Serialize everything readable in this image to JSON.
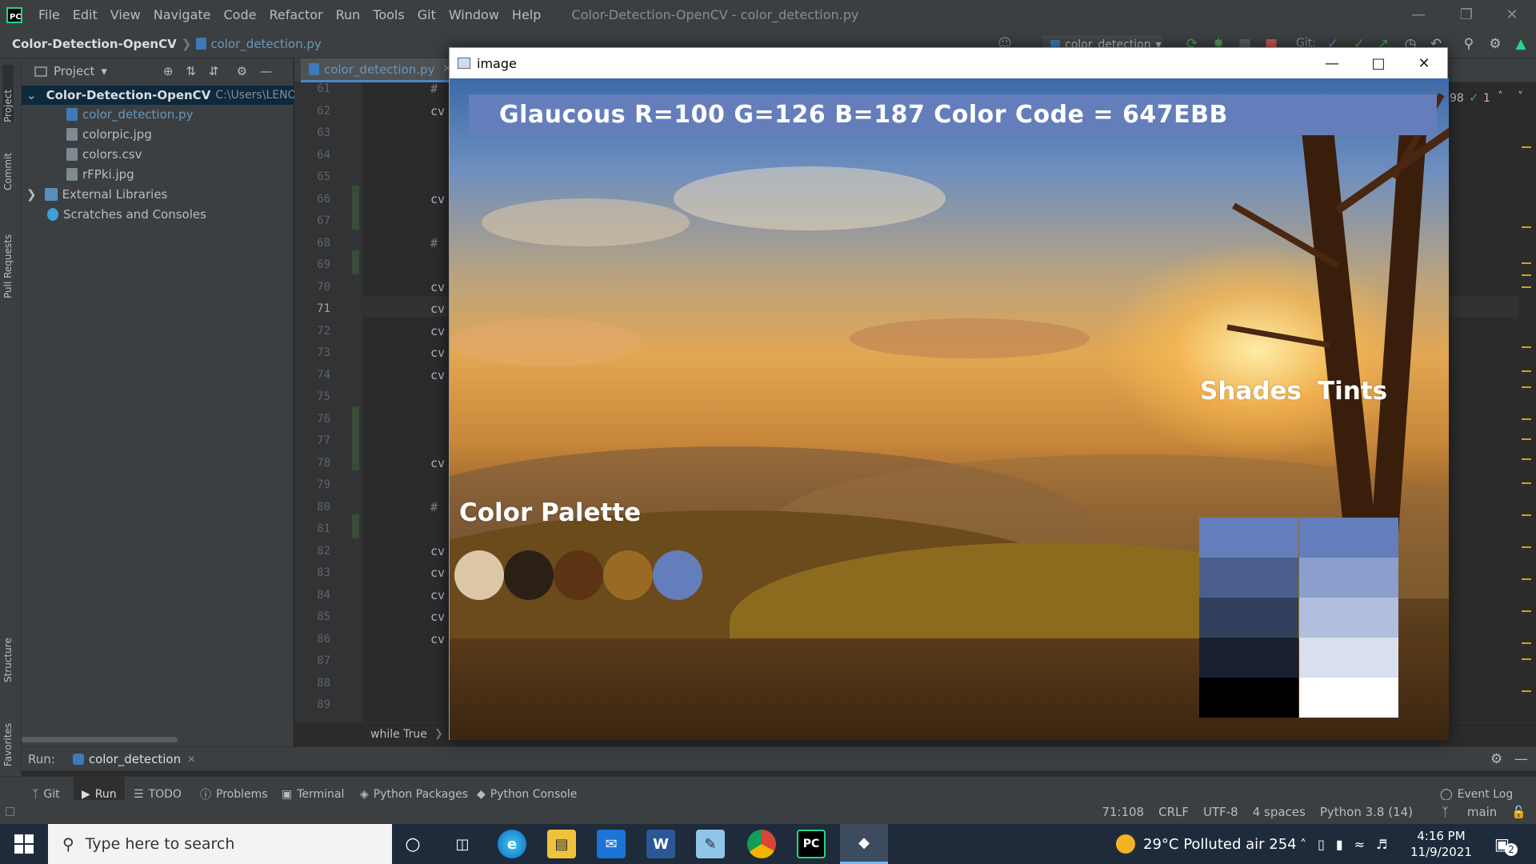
{
  "menubar": {
    "items": [
      "File",
      "Edit",
      "View",
      "Navigate",
      "Code",
      "Refactor",
      "Run",
      "Tools",
      "Git",
      "Window",
      "Help"
    ],
    "window_title": "Color-Detection-OpenCV - color_detection.py"
  },
  "navbar": {
    "project": "Color-Detection-OpenCV",
    "file": "color_detection.py",
    "run_config": "color_detection",
    "git_label": "Git:"
  },
  "left_tabs": [
    "Project",
    "Commit",
    "Pull Requests",
    "Structure",
    "Favorites"
  ],
  "project_panel": {
    "header": "Project",
    "root": "Color-Detection-OpenCV",
    "root_path": "C:\\Users\\LENOV",
    "files": [
      "color_detection.py",
      "colorpic.jpg",
      "colors.csv",
      "rFPki.jpg"
    ],
    "external": "External Libraries",
    "scratches": "Scratches and Consoles"
  },
  "editor": {
    "tab": "color_detection.py",
    "line_numbers": [
      "61",
      "62",
      "63",
      "64",
      "65",
      "66",
      "67",
      "68",
      "69",
      "70",
      "71",
      "72",
      "73",
      "74",
      "75",
      "76",
      "77",
      "78",
      "79",
      "80",
      "81",
      "82",
      "83",
      "84",
      "85",
      "86",
      "87",
      "88",
      "89"
    ],
    "current_line": "71",
    "code_fragments": {
      "l61": "#",
      "l62": "cv",
      "l66": "cv",
      "l68": "#",
      "l70": "cv",
      "l71": "cv",
      "l72": "cv",
      "l73": "cv",
      "l74": "cv",
      "l78": "cv",
      "l80": "#",
      "l82": "cv",
      "l83": "cv",
      "l84": "cv",
      "l85": "cv",
      "l86": "cv"
    },
    "breadcrumb": "while True",
    "inspection_count": "98",
    "inspection_ok": "1"
  },
  "run_panel": {
    "label": "Run:",
    "config": "color_detection"
  },
  "bottom_tabs": [
    "Git",
    "Run",
    "TODO",
    "Problems",
    "Terminal",
    "Python Packages",
    "Python Console"
  ],
  "event_log": "Event Log",
  "statusbar": {
    "position": "71:108",
    "line_sep": "CRLF",
    "encoding": "UTF-8",
    "indent": "4 spaces",
    "interpreter": "Python 3.8 (14)",
    "branch": "main"
  },
  "taskbar": {
    "search_placeholder": "Type here to search",
    "weather": "29°C  Polluted air 254",
    "time": "4:16 PM",
    "date": "11/9/2021",
    "notifications": "2"
  },
  "image_window": {
    "title": "image",
    "banner": "Glaucous R=100 G=126 B=187 Color Code = 647EBB",
    "banner_color": "#647ebb",
    "palette_label": "Color Palette",
    "palette": [
      "#dcc7a6",
      "#2a2016",
      "#5c3313",
      "#9a6a24",
      "#647ebb"
    ],
    "shades_label": "Shades",
    "tints_label": "Tints",
    "shades": [
      "#647ebb",
      "#4b5e8c",
      "#32405e",
      "#19202f",
      "#000000"
    ],
    "tints": [
      "#647ebb",
      "#8b9ecc",
      "#b1bedd",
      "#d8dfee",
      "#ffffff"
    ]
  }
}
